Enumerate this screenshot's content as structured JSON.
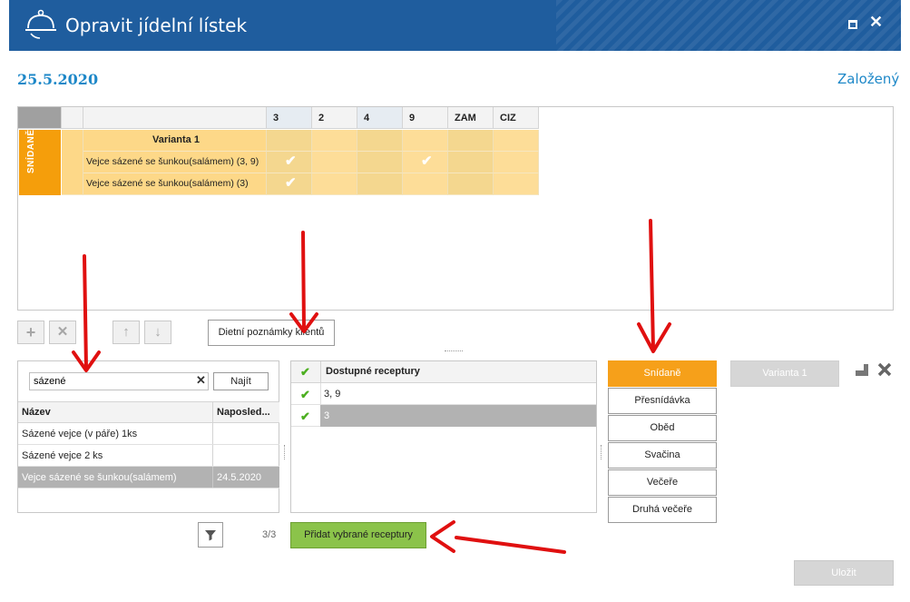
{
  "window": {
    "title": "Opravit jídelní lístek"
  },
  "header": {
    "date": "25.5.2020",
    "status": "Založený"
  },
  "menu_grid": {
    "columns": [
      "3",
      "2",
      "4",
      "9",
      "ZAM",
      "CIZ"
    ],
    "section": "SNÍDANĚ",
    "variant_label": "Varianta 1",
    "rows": [
      {
        "name": "Vejce sázené se šunkou(salámem) (3, 9)",
        "checks": [
          true,
          false,
          false,
          true,
          false,
          false
        ]
      },
      {
        "name": "Vejce sázené se šunkou(salámem) (3)",
        "checks": [
          true,
          false,
          false,
          false,
          false,
          false
        ]
      }
    ]
  },
  "toolbar": {
    "add_icon": "plus-icon",
    "delete_icon": "x-icon",
    "up_icon": "arrow-up-icon",
    "down_icon": "arrow-down-icon",
    "diet_notes_label": "Dietní poznámky klientů"
  },
  "search": {
    "value": "sázené",
    "button_label": "Najít",
    "columns": [
      "Název",
      "Naposled..."
    ],
    "rows": [
      {
        "name": "Sázené vejce (v páře) 1ks",
        "last": ""
      },
      {
        "name": "Sázené vejce 2 ks",
        "last": ""
      },
      {
        "name": "Vejce sázené se šunkou(salámem)",
        "last": "24.5.2020"
      }
    ],
    "count": "3/3"
  },
  "recipes": {
    "header": "Dostupné receptury",
    "rows": [
      "3, 9",
      "3"
    ]
  },
  "meals": [
    "Snídaně",
    "Přesnídávka",
    "Oběd",
    "Svačina",
    "Večeře",
    "Druhá večeře"
  ],
  "variant_button": "Varianta 1",
  "actions": {
    "add_recipes": "Přidat vybrané receptury",
    "save": "Uložit"
  },
  "colors": {
    "titlebar": "#1f5d9e",
    "accent": "#1e88c8",
    "section_orange": "#f59e0b",
    "add_green": "#8bc34a",
    "annotation_red": "#e01010"
  }
}
